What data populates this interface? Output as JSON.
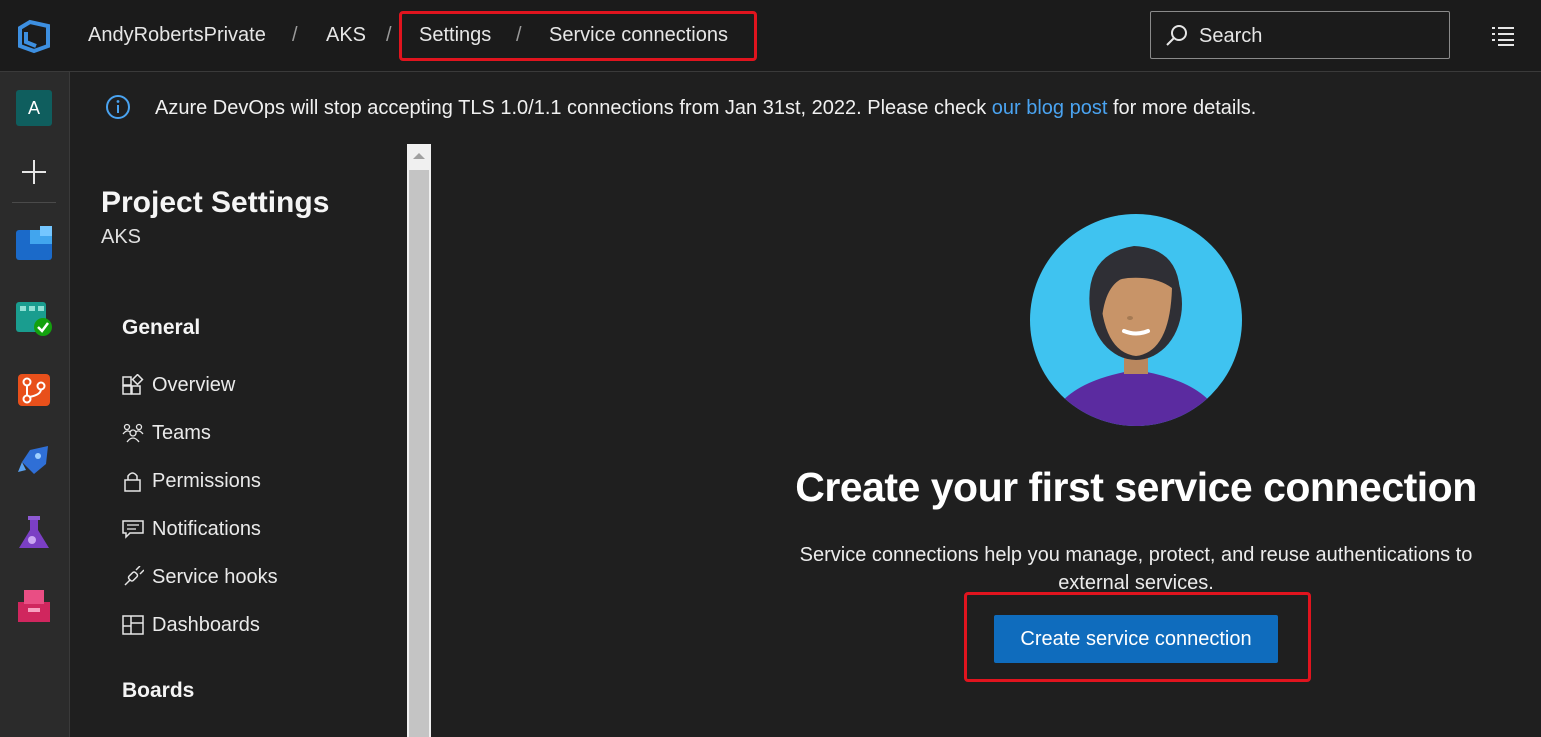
{
  "breadcrumb": {
    "org": "AndyRobertsPrivate",
    "project": "AKS",
    "settings": "Settings",
    "page": "Service connections",
    "separator": "/"
  },
  "search": {
    "placeholder": "Search"
  },
  "rail": {
    "avatar_letter": "A",
    "items": [
      "plus-icon",
      "overview-icon",
      "boards-icon",
      "repos-icon",
      "pipelines-icon",
      "test-plans-icon",
      "artifacts-icon"
    ]
  },
  "banner": {
    "text_before": "Azure DevOps will stop accepting TLS 1.0/1.1 connections from Jan 31st, 2022. Please check ",
    "link": "our blog post",
    "text_after": " for more details."
  },
  "sidebar": {
    "title": "Project Settings",
    "subtitle": "AKS",
    "sections": [
      {
        "label": "General",
        "items": [
          {
            "label": "Overview",
            "icon": "overview-icon"
          },
          {
            "label": "Teams",
            "icon": "teams-icon"
          },
          {
            "label": "Permissions",
            "icon": "lock-icon"
          },
          {
            "label": "Notifications",
            "icon": "notification-icon"
          },
          {
            "label": "Service hooks",
            "icon": "service-hooks-icon"
          },
          {
            "label": "Dashboards",
            "icon": "dashboards-icon"
          }
        ]
      },
      {
        "label": "Boards",
        "items": []
      }
    ]
  },
  "main": {
    "title": "Create your first service connection",
    "description": "Service connections help you manage, protect, and reuse authentications to external services.",
    "button": "Create service connection"
  },
  "colors": {
    "accent": "#0f6cbd",
    "highlight": "#e0141e",
    "link": "#4aa3f0"
  }
}
